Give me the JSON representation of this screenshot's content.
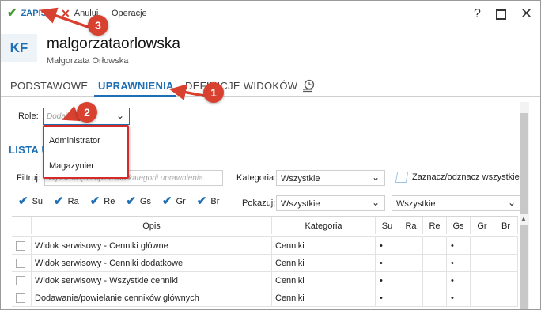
{
  "toolbar": {
    "save_label": "ZAPISZ",
    "cancel_label": "Anuluj",
    "operations_label": "Operacje",
    "help_glyph": "?",
    "close_glyph": "✕"
  },
  "header": {
    "avatar_initials": "KF",
    "login": "malgorzataorlowska",
    "full_name": "Małgorzata Orłowska"
  },
  "tabs": [
    {
      "label": "PODSTAWOWE",
      "active": false
    },
    {
      "label": "UPRAWNIENIA",
      "active": true
    },
    {
      "label": "DEFINICJE WIDOKÓW",
      "active": false
    }
  ],
  "roles": {
    "label": "Role:",
    "placeholder": "Dodaj role",
    "options": [
      "Administrator",
      "Magazynier"
    ]
  },
  "section_title": "LISTA UPRAWNIEŃ",
  "filters": {
    "filter_label": "Filtruj:",
    "filter_placeholder": "Wpisz część opisu lub kategorii uprawnienia...",
    "category_label": "Kategoria:",
    "category_value": "Wszystkie",
    "toggle_all_label": "Zaznacz/odznacz wszystkie",
    "show_label": "Pokazuj:",
    "show_value": "Wszystkie",
    "show_value_2": "Wszystkie",
    "checkboxes": [
      "Su",
      "Ra",
      "Re",
      "Gs",
      "Gr",
      "Br"
    ]
  },
  "table": {
    "columns": [
      "Opis",
      "Kategoria",
      "Su",
      "Ra",
      "Re",
      "Gs",
      "Gr",
      "Br"
    ],
    "rows": [
      {
        "opis": "Widok serwisowy - Cenniki główne",
        "kategoria": "Cenniki",
        "su": "•",
        "ra": "",
        "re": "",
        "gs": "•",
        "gr": "",
        "br": ""
      },
      {
        "opis": "Widok serwisowy - Cenniki dodatkowe",
        "kategoria": "Cenniki",
        "su": "•",
        "ra": "",
        "re": "",
        "gs": "•",
        "gr": "",
        "br": ""
      },
      {
        "opis": "Widok serwisowy - Wszystkie cenniki",
        "kategoria": "Cenniki",
        "su": "•",
        "ra": "",
        "re": "",
        "gs": "•",
        "gr": "",
        "br": ""
      },
      {
        "opis": "Dodawanie/powielanie cenników głównych",
        "kategoria": "Cenniki",
        "su": "•",
        "ra": "",
        "re": "",
        "gs": "•",
        "gr": "",
        "br": ""
      }
    ]
  },
  "annotations": [
    "1",
    "2",
    "3"
  ],
  "colors": {
    "accent": "#1e6fb5",
    "annotation": "#d84030",
    "save_check": "#3a9a2a",
    "cancel_x": "#d23b2a"
  }
}
